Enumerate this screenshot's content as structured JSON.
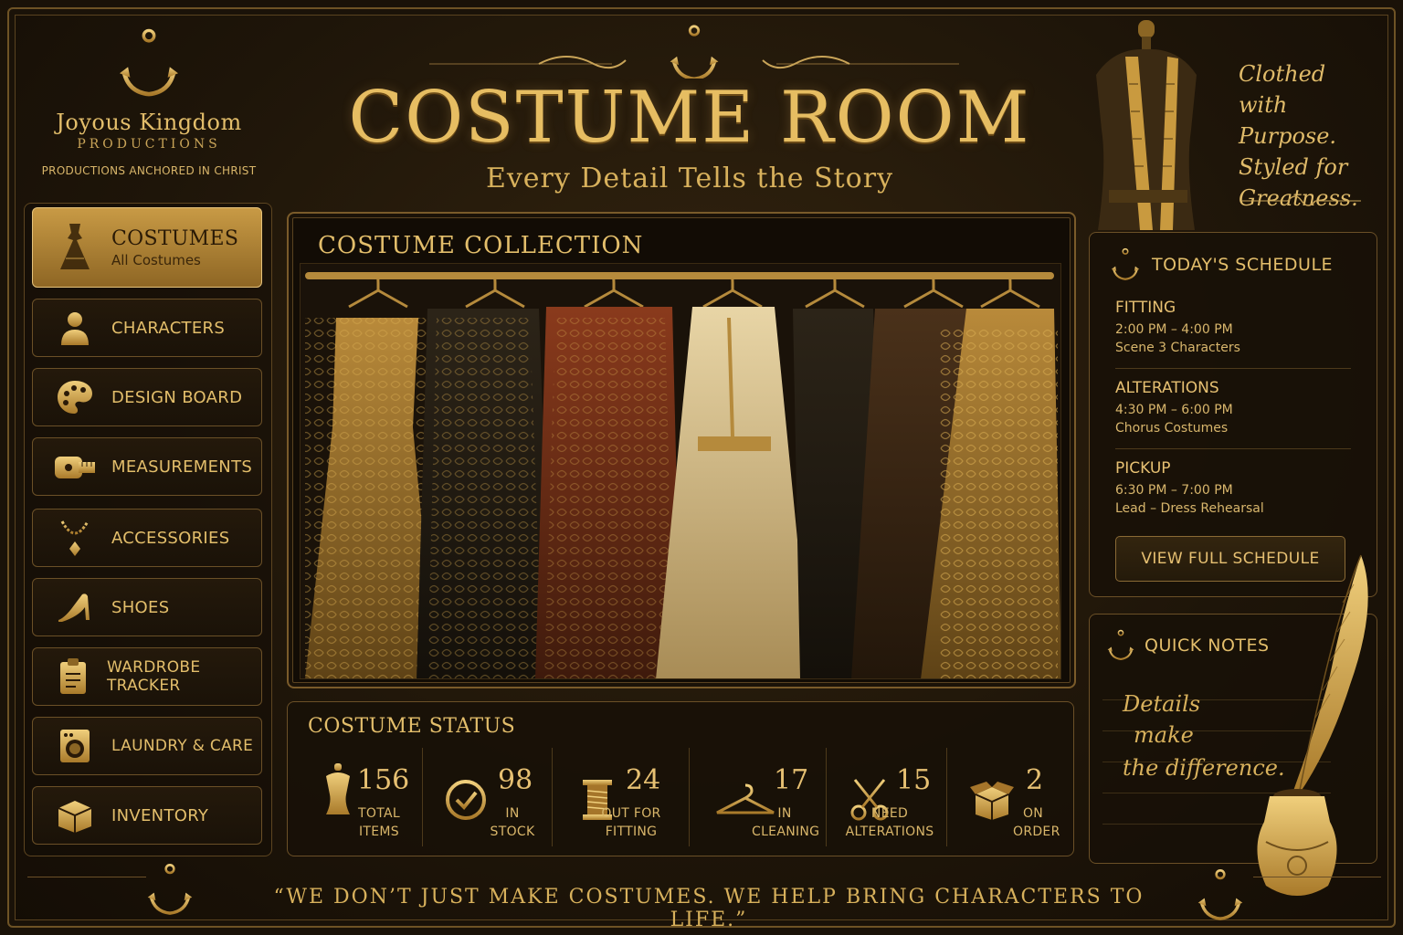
{
  "brand": {
    "name": "Joyous Kingdom",
    "sub": "PRODUCTIONS",
    "tagline": "PRODUCTIONS ANCHORED IN CHRIST"
  },
  "header": {
    "title": "COSTUME ROOM",
    "subtitle": "Every Detail Tells the Story"
  },
  "quote": {
    "line1": "Clothed with",
    "line2": "Purpose.",
    "line3": "Styled for",
    "line4": "Greatness."
  },
  "sidebar": {
    "items": [
      {
        "label": "COSTUMES",
        "sublabel": "All Costumes",
        "icon": "dress-icon"
      },
      {
        "label": "CHARACTERS",
        "icon": "person-icon"
      },
      {
        "label": "DESIGN BOARD",
        "icon": "palette-icon"
      },
      {
        "label": "MEASUREMENTS",
        "icon": "tape-measure-icon"
      },
      {
        "label": "ACCESSORIES",
        "icon": "necklace-icon"
      },
      {
        "label": "SHOES",
        "icon": "high-heel-icon"
      },
      {
        "label": "WARDROBE TRACKER",
        "icon": "clipboard-icon"
      },
      {
        "label": "LAUNDRY & CARE",
        "icon": "washing-machine-icon"
      },
      {
        "label": "INVENTORY",
        "icon": "box-icon"
      }
    ]
  },
  "collection": {
    "title": "COSTUME COLLECTION"
  },
  "status": {
    "title": "COSTUME STATUS",
    "stats": [
      {
        "value": "156",
        "line1": "TOTAL",
        "line2": "ITEMS",
        "icon": "dress-form-icon"
      },
      {
        "value": "98",
        "line1": "IN",
        "line2": "STOCK",
        "icon": "check-circle-icon"
      },
      {
        "value": "24",
        "line1": "OUT FOR",
        "line2": "FITTING",
        "icon": "thread-spool-icon"
      },
      {
        "value": "17",
        "line1": "IN",
        "line2": "CLEANING",
        "icon": "hanger-icon"
      },
      {
        "value": "15",
        "line1": "NEED",
        "line2": "ALTERATIONS",
        "icon": "scissors-icon"
      },
      {
        "value": "2",
        "line1": "ON",
        "line2": "ORDER",
        "icon": "open-box-icon"
      }
    ]
  },
  "schedule": {
    "title": "TODAY'S SCHEDULE",
    "items": [
      {
        "heading": "FITTING",
        "time": "2:00 PM – 4:00 PM",
        "detail": "Scene 3 Characters"
      },
      {
        "heading": "ALTERATIONS",
        "time": "4:30 PM – 6:00 PM",
        "detail": "Chorus Costumes"
      },
      {
        "heading": "PICKUP",
        "time": "6:30 PM – 7:00 PM",
        "detail": "Lead – Dress Rehearsal"
      }
    ],
    "button": "VIEW FULL SCHEDULE"
  },
  "notes": {
    "title": "QUICK NOTES",
    "line1": "Details",
    "line2": "make",
    "line3": "the difference."
  },
  "footer": {
    "quote": "“WE DON’T JUST MAKE COSTUMES. WE HELP BRING CHARACTERS TO LIFE.”"
  },
  "colors": {
    "gold": "#e0b95f",
    "dark": "#1a1208",
    "accent": "#c89a45"
  }
}
